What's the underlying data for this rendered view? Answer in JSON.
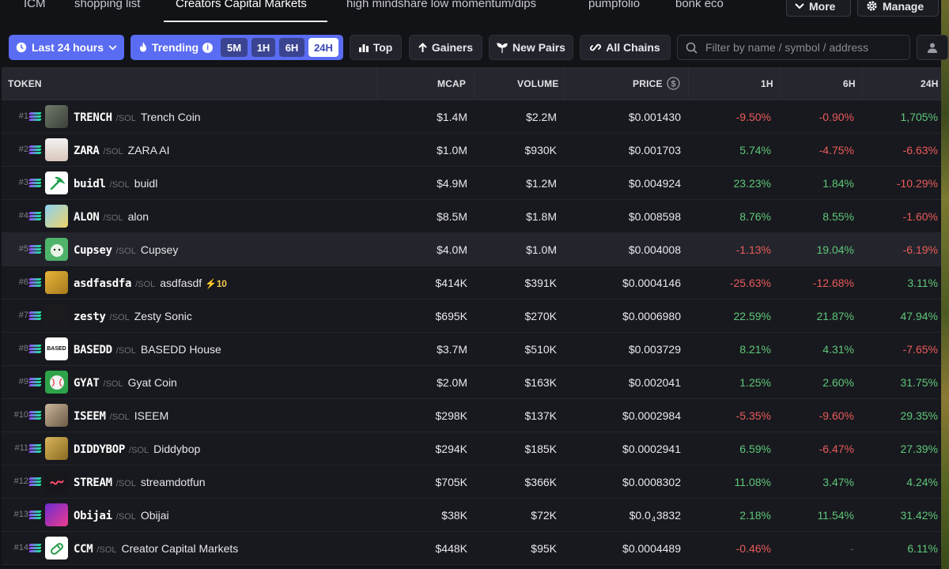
{
  "tabs": [
    {
      "label": "ICM",
      "active": false
    },
    {
      "label": "shopping list",
      "active": false
    },
    {
      "label": "Creators Capital Markets",
      "active": true
    },
    {
      "label": "high mindshare low momentum/dips",
      "active": false
    },
    {
      "label": "pumpfolio",
      "active": false
    },
    {
      "label": "bonk eco",
      "active": false
    }
  ],
  "more_label": "More",
  "manage_label": "Manage",
  "toolbar": {
    "timeframe_label": "Last 24 hours",
    "trending_label": "Trending",
    "trending_intervals": [
      "5M",
      "1H",
      "6H",
      "24H"
    ],
    "trending_selected": "24H",
    "top_label": "Top",
    "gainers_label": "Gainers",
    "new_pairs_label": "New Pairs",
    "all_chains_label": "All Chains",
    "search_placeholder": "Filter by name / symbol / address"
  },
  "columns": {
    "token": "TOKEN",
    "mcap": "MCAP",
    "volume": "VOLUME",
    "price": "PRICE",
    "h1": "1H",
    "h6": "6H",
    "h24": "24H"
  },
  "colors": {
    "accent": "#5a6cf2",
    "positive": "#5ec77a",
    "negative": "#ea5b5b"
  },
  "rows": [
    {
      "rank": "#1",
      "symbol": "TRENCH",
      "pair": "/SOL",
      "name": "Trench Coin",
      "mcap": "$1.4M",
      "volume": "$2.2M",
      "price": "$0.001430",
      "h1": "-9.50%",
      "h6": "-0.90%",
      "h24": "1,705%",
      "avatar": "trench-avatar"
    },
    {
      "rank": "#2",
      "symbol": "ZARA",
      "pair": "/SOL",
      "name": "ZARA AI",
      "mcap": "$1.0M",
      "volume": "$930K",
      "price": "$0.001703",
      "h1": "5.74%",
      "h6": "-4.75%",
      "h24": "-6.63%",
      "avatar": "zara-avatar"
    },
    {
      "rank": "#3",
      "symbol": "buidl",
      "pair": "/SOL",
      "name": "buidl",
      "mcap": "$4.9M",
      "volume": "$1.2M",
      "price": "$0.004924",
      "h1": "23.23%",
      "h6": "1.84%",
      "h24": "-10.29%",
      "avatar": "buidl-avatar"
    },
    {
      "rank": "#4",
      "symbol": "ALON",
      "pair": "/SOL",
      "name": "alon",
      "mcap": "$8.5M",
      "volume": "$1.8M",
      "price": "$0.008598",
      "h1": "8.76%",
      "h6": "8.55%",
      "h24": "-1.60%",
      "avatar": "alon-avatar"
    },
    {
      "rank": "#5",
      "symbol": "Cupsey",
      "pair": "/SOL",
      "name": "Cupsey",
      "mcap": "$4.0M",
      "volume": "$1.0M",
      "price": "$0.004008",
      "h1": "-1.13%",
      "h6": "19.04%",
      "h24": "-6.19%",
      "avatar": "cupsey-avatar"
    },
    {
      "rank": "#6",
      "symbol": "asdfasdfa",
      "pair": "/SOL",
      "name": "asdfasdf",
      "boost": "10",
      "mcap": "$414K",
      "volume": "$391K",
      "price": "$0.0004146",
      "h1": "-25.63%",
      "h6": "-12.68%",
      "h24": "3.11%",
      "avatar": "asdfasdfa-avatar"
    },
    {
      "rank": "#7",
      "symbol": "zesty",
      "pair": "/SOL",
      "name": "Zesty Sonic",
      "mcap": "$695K",
      "volume": "$270K",
      "price": "$0.0006980",
      "h1": "22.59%",
      "h6": "21.87%",
      "h24": "47.94%",
      "avatar": "zesty-avatar"
    },
    {
      "rank": "#8",
      "symbol": "BASEDD",
      "pair": "/SOL",
      "name": "BASEDD House",
      "mcap": "$3.7M",
      "volume": "$510K",
      "price": "$0.003729",
      "h1": "8.21%",
      "h6": "4.31%",
      "h24": "-7.65%",
      "avatar": "basedd-avatar",
      "avatar_text": "BASED"
    },
    {
      "rank": "#9",
      "symbol": "GYAT",
      "pair": "/SOL",
      "name": "Gyat Coin",
      "mcap": "$2.0M",
      "volume": "$163K",
      "price": "$0.002041",
      "h1": "1.25%",
      "h6": "2.60%",
      "h24": "31.75%",
      "avatar": "gyat-avatar"
    },
    {
      "rank": "#10",
      "symbol": "ISEEM",
      "pair": "/SOL",
      "name": "ISEEM",
      "mcap": "$298K",
      "volume": "$137K",
      "price": "$0.0002984",
      "h1": "-5.35%",
      "h6": "-9.60%",
      "h24": "29.35%",
      "avatar": "iseem-avatar"
    },
    {
      "rank": "#11",
      "symbol": "DIDDYBOP",
      "pair": "/SOL",
      "name": "Diddybop",
      "mcap": "$294K",
      "volume": "$185K",
      "price": "$0.0002941",
      "h1": "6.59%",
      "h6": "-6.47%",
      "h24": "27.39%",
      "avatar": "diddybop-avatar"
    },
    {
      "rank": "#12",
      "symbol": "STREAM",
      "pair": "/SOL",
      "name": "streamdotfun",
      "mcap": "$705K",
      "volume": "$366K",
      "price": "$0.0008302",
      "h1": "11.08%",
      "h6": "3.47%",
      "h24": "4.24%",
      "avatar": "stream-avatar"
    },
    {
      "rank": "#13",
      "symbol": "Obijai",
      "pair": "/SOL",
      "name": "Obijai",
      "mcap": "$38K",
      "volume": "$72K",
      "price_prefix": "$0.0",
      "price_sub": "4",
      "price_rest": "3832",
      "h1": "2.18%",
      "h6": "11.54%",
      "h24": "31.42%",
      "avatar": "obijai-avatar"
    },
    {
      "rank": "#14",
      "symbol": "CCM",
      "pair": "/SOL",
      "name": "Creator Capital Markets",
      "mcap": "$448K",
      "volume": "$95K",
      "price": "$0.0004489",
      "h1": "-0.46%",
      "h6": "-",
      "h24": "6.11%",
      "avatar": "ccm-avatar"
    }
  ]
}
